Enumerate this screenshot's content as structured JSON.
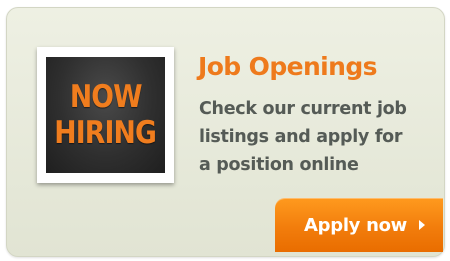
{
  "badge": {
    "line1": "NOW",
    "line2": "HIRING"
  },
  "title": "Job Openings",
  "description": [
    "Check our current job",
    "listings and apply for",
    "a position online"
  ],
  "button": {
    "label": "Apply now",
    "icon": "arrow-right-icon"
  },
  "colors": {
    "accent": "#f07d1e",
    "badge_bg": "#2f2f2f",
    "card_bg": "#e6e9da",
    "text": "#555b56"
  }
}
